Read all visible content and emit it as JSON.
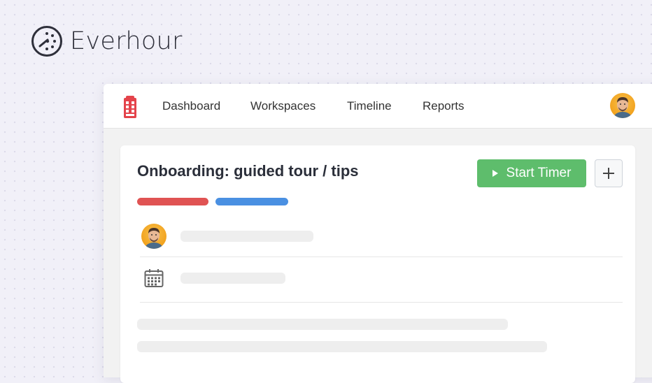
{
  "brand": {
    "name": "Everhour"
  },
  "nav": {
    "items": [
      {
        "label": "Dashboard"
      },
      {
        "label": "Workspaces"
      },
      {
        "label": "Timeline"
      },
      {
        "label": "Reports"
      }
    ]
  },
  "task": {
    "title": "Onboarding: guided tour / tips",
    "start_label": "Start Timer",
    "add_label": "+",
    "tags": [
      {
        "color": "#e05353"
      },
      {
        "color": "#4a90e2"
      }
    ]
  },
  "colors": {
    "accent_green": "#5ebd6c",
    "brand_red": "#e4434b",
    "avatar_orange": "#f2a21d"
  },
  "icons": [
    "everhour-logo-icon",
    "phone-booth-icon",
    "avatar",
    "play-icon",
    "plus-icon",
    "calendar-icon"
  ]
}
